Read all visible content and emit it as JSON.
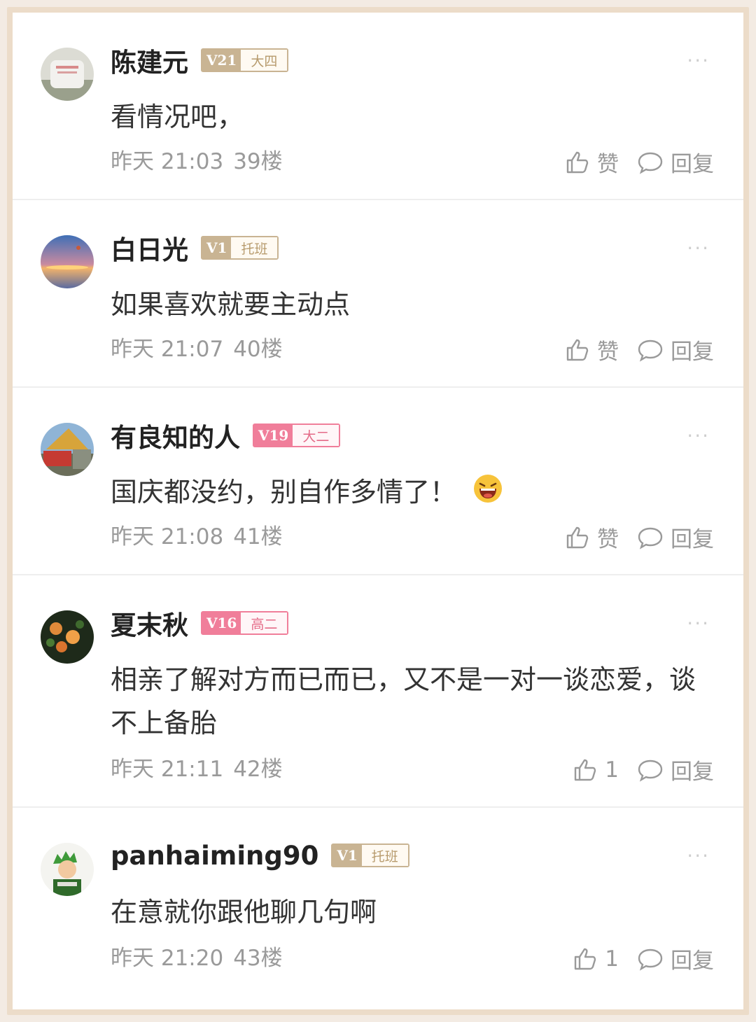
{
  "comments": [
    {
      "username": "陈建元",
      "level": "V21",
      "grade": "大四",
      "text": "看情况吧，",
      "time": "昨天 21:03",
      "floor": "39楼",
      "like_label": "赞",
      "reply_label": "回复",
      "more": "···"
    },
    {
      "username": "白日光",
      "level": "V1",
      "grade": "托班",
      "text": "如果喜欢就要主动点",
      "time": "昨天 21:07",
      "floor": "40楼",
      "like_label": "赞",
      "reply_label": "回复",
      "more": "···"
    },
    {
      "username": "有良知的人",
      "level": "V19",
      "grade": "大二",
      "text": "国庆都没约，别自作多情了！",
      "time": "昨天 21:08",
      "floor": "41楼",
      "like_label": "赞",
      "reply_label": "回复",
      "more": "···"
    },
    {
      "username": "夏末秋",
      "level": "V16",
      "grade": "高二",
      "text": "相亲了解对方而已而已，又不是一对一谈恋爱，谈不上备胎",
      "time": "昨天 21:11",
      "floor": "42楼",
      "like_label": "1",
      "reply_label": "回复",
      "more": "···"
    },
    {
      "username": "panhaiming90",
      "level": "V1",
      "grade": "托班",
      "text": "在意就你跟他聊几句啊",
      "time": "昨天 21:20",
      "floor": "43楼",
      "like_label": "1",
      "reply_label": "回复",
      "more": "···"
    }
  ],
  "colors": {
    "badge_gold": "#c9b493",
    "badge_pink": "#f07e9a",
    "meta_gray": "#9a9a9a"
  },
  "icons": [
    "thumbs-up-icon",
    "speech-bubble-icon",
    "more-dots-icon",
    "laughing-emoji-icon"
  ]
}
